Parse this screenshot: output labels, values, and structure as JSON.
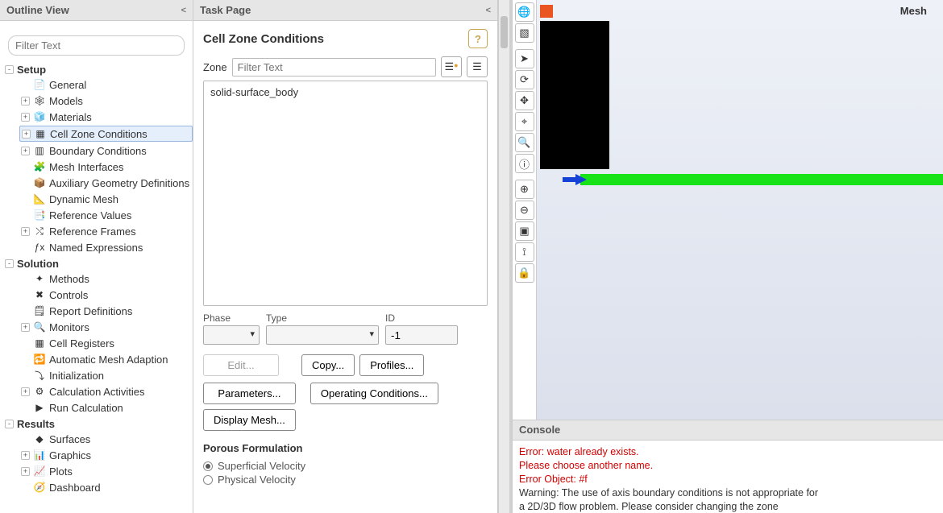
{
  "outline": {
    "title": "Outline View",
    "filter_placeholder": "Filter Text",
    "items": [
      {
        "key": "setup",
        "label": "Setup",
        "cat": true,
        "tw": "-",
        "children": [
          {
            "key": "general",
            "label": "General",
            "icon": "📄"
          },
          {
            "key": "models",
            "label": "Models",
            "icon": "🕸",
            "tw": "+"
          },
          {
            "key": "materials",
            "label": "Materials",
            "icon": "🧊",
            "tw": "+"
          },
          {
            "key": "cellzone",
            "label": "Cell Zone Conditions",
            "icon": "▦",
            "tw": "+",
            "selected": true
          },
          {
            "key": "boundary",
            "label": "Boundary Conditions",
            "icon": "▥",
            "tw": "+"
          },
          {
            "key": "meshif",
            "label": "Mesh Interfaces",
            "icon": "🧩"
          },
          {
            "key": "auxgeo",
            "label": "Auxiliary Geometry Definitions",
            "icon": "📦"
          },
          {
            "key": "dynmesh",
            "label": "Dynamic Mesh",
            "icon": "📐"
          },
          {
            "key": "refval",
            "label": "Reference Values",
            "icon": "📑"
          },
          {
            "key": "refframes",
            "label": "Reference Frames",
            "icon": "⤭",
            "tw": "+"
          },
          {
            "key": "namedexpr",
            "label": "Named Expressions",
            "icon": "ƒx"
          }
        ]
      },
      {
        "key": "solution",
        "label": "Solution",
        "cat": true,
        "tw": "-",
        "children": [
          {
            "key": "methods",
            "label": "Methods",
            "icon": "✦"
          },
          {
            "key": "controls",
            "label": "Controls",
            "icon": "✖"
          },
          {
            "key": "reportdefs",
            "label": "Report Definitions",
            "icon": "🗒"
          },
          {
            "key": "monitors",
            "label": "Monitors",
            "icon": "🔍",
            "tw": "+"
          },
          {
            "key": "cellreg",
            "label": "Cell Registers",
            "icon": "▦"
          },
          {
            "key": "automesh",
            "label": "Automatic Mesh Adaption",
            "icon": "🔁"
          },
          {
            "key": "init",
            "label": "Initialization",
            "icon": "⤵"
          },
          {
            "key": "calcact",
            "label": "Calculation Activities",
            "icon": "⚙",
            "tw": "+"
          },
          {
            "key": "runcalc",
            "label": "Run Calculation",
            "icon": "▶"
          }
        ]
      },
      {
        "key": "results",
        "label": "Results",
        "cat": true,
        "tw": "-",
        "children": [
          {
            "key": "surfaces",
            "label": "Surfaces",
            "icon": "◆"
          },
          {
            "key": "graphics",
            "label": "Graphics",
            "icon": "📊",
            "tw": "+"
          },
          {
            "key": "plots",
            "label": "Plots",
            "icon": "📈",
            "tw": "+"
          },
          {
            "key": "dashboard",
            "label": "Dashboard",
            "icon": "🧭"
          }
        ]
      }
    ]
  },
  "task": {
    "header": "Task Page",
    "title": "Cell Zone Conditions",
    "zone_label": "Zone",
    "zone_filter_placeholder": "Filter Text",
    "zone_items": [
      "solid-surface_body"
    ],
    "phase_label": "Phase",
    "type_label": "Type",
    "id_label": "ID",
    "id_value": "-1",
    "btn_edit": "Edit...",
    "btn_copy": "Copy...",
    "btn_profiles": "Profiles...",
    "btn_params": "Parameters...",
    "btn_opcond": "Operating Conditions...",
    "btn_dispmesh": "Display Mesh...",
    "porous_title": "Porous Formulation",
    "radio_superficial": "Superficial Velocity",
    "radio_physical": "Physical Velocity"
  },
  "graphics": {
    "view_label": "Mesh",
    "tools": [
      {
        "name": "orbit-tool",
        "glyph": "🌐"
      },
      {
        "name": "box-tool",
        "glyph": "▧"
      },
      {
        "sep": true
      },
      {
        "name": "pointer-tool",
        "glyph": "➤"
      },
      {
        "name": "rotate-tool",
        "glyph": "⟳"
      },
      {
        "name": "pan-tool",
        "glyph": "✥"
      },
      {
        "name": "zoom-area-tool",
        "glyph": "⌖"
      },
      {
        "name": "zoom-tool",
        "glyph": "🔍"
      },
      {
        "name": "info-tool",
        "glyph": "ⓘ"
      },
      {
        "sep": true
      },
      {
        "name": "zoom-in-tool",
        "glyph": "⊕"
      },
      {
        "name": "zoom-out-tool",
        "glyph": "⊖"
      },
      {
        "name": "fit-tool",
        "glyph": "▣"
      },
      {
        "name": "axes-tool",
        "glyph": "⟟"
      },
      {
        "name": "lock-tool",
        "glyph": "🔒"
      }
    ]
  },
  "console": {
    "title": "Console",
    "lines": [
      {
        "cls": "err",
        "text": "Error: water already exists."
      },
      {
        "cls": "err",
        "text": "Please choose another name."
      },
      {
        "cls": "err",
        "text": "Error Object: #f"
      },
      {
        "cls": "",
        "text": "Warning: The use of axis boundary conditions is not appropriate for"
      },
      {
        "cls": "",
        "text": "         a 2D/3D flow problem. Please consider changing the zone"
      }
    ]
  }
}
